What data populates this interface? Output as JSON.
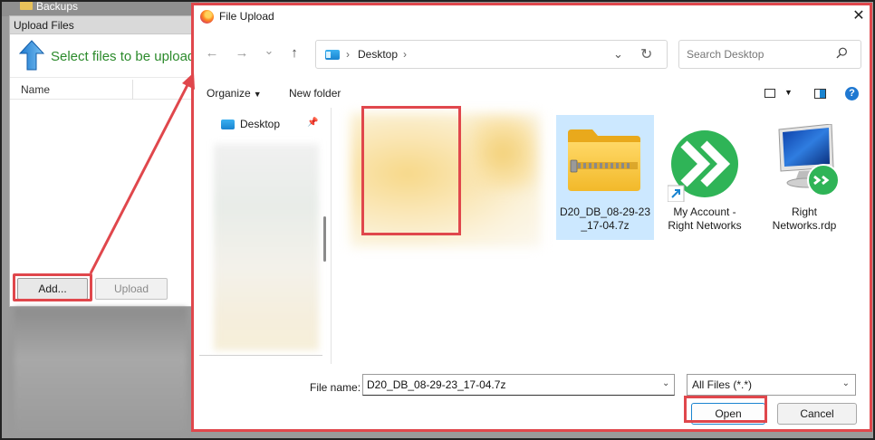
{
  "background": {
    "top_item_label": "Backups",
    "upload_window": {
      "title": "Upload Files",
      "heading": "Select files to be uploaded",
      "column_name": "Name",
      "add_button": "Add...",
      "upload_button": "Upload"
    }
  },
  "dialog": {
    "title": "File Upload",
    "close_glyph": "✕",
    "nav": {
      "back_glyph": "←",
      "forward_glyph": "→",
      "recent_glyph": "⌄",
      "up_glyph": "↑",
      "crumb_sep": "›",
      "location": "Desktop",
      "dropdown_glyph": "⌄",
      "refresh_glyph": "↻",
      "search_placeholder": "Search Desktop"
    },
    "command_bar": {
      "organize": "Organize",
      "new_folder": "New folder",
      "help": "?"
    },
    "sidebar": {
      "items": [
        {
          "label": "Desktop",
          "pinned": true
        }
      ]
    },
    "files": [
      {
        "name": "D20_DB_08-29-23_17-04.7z",
        "label_line1": "D20_DB_08-29-23",
        "label_line2": "_17-04.7z",
        "type": "zip-folder",
        "selected": true
      },
      {
        "name": "My Account - Right Networks",
        "label_line1": "My Account -",
        "label_line2": "Right Networks",
        "type": "shortcut"
      },
      {
        "name": "Right Networks.rdp",
        "label_line1": "Right",
        "label_line2": "Networks.rdp",
        "type": "rdp"
      }
    ],
    "bottom": {
      "file_name_label": "File name:",
      "file_name_value": "D20_DB_08-29-23_17-04.7z",
      "file_type": "All Files (*.*)",
      "open_button": "Open",
      "cancel_button": "Cancel"
    }
  },
  "colors": {
    "highlight": "#e0474c",
    "accent": "#1a84d0",
    "selection": "#cce8ff",
    "heading_green": "#2b8a2b"
  }
}
